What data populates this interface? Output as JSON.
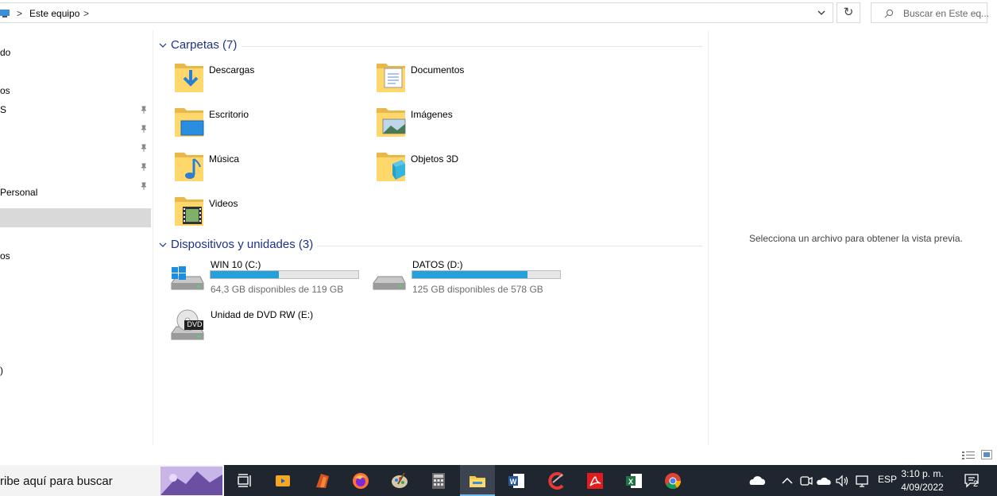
{
  "address": {
    "crumb": "Este equipo",
    "separator": ">",
    "refresh_glyph": "↻"
  },
  "search": {
    "placeholder": "Buscar en Este eq..."
  },
  "nav": {
    "items": [
      {
        "label": "do",
        "pinned": false
      },
      {
        "label": "os",
        "pinned": true
      },
      {
        "label": "S",
        "pinned": true
      },
      {
        "label": "",
        "pinned": true
      },
      {
        "label": "",
        "pinned": true
      },
      {
        "label": "",
        "pinned": true
      },
      {
        "label": "Personal",
        "pinned": false
      },
      {
        "label": "os",
        "pinned": false
      },
      {
        "label": ")",
        "pinned": false
      }
    ]
  },
  "folders_group": {
    "title": "Carpetas (7)"
  },
  "folders": [
    {
      "label": "Descargas",
      "icon": "downloads-folder-icon"
    },
    {
      "label": "Documentos",
      "icon": "documents-folder-icon"
    },
    {
      "label": "Escritorio",
      "icon": "desktop-folder-icon"
    },
    {
      "label": "Imágenes",
      "icon": "pictures-folder-icon"
    },
    {
      "label": "Música",
      "icon": "music-folder-icon"
    },
    {
      "label": "Objetos 3D",
      "icon": "3d-objects-folder-icon"
    },
    {
      "label": "Videos",
      "icon": "videos-folder-icon"
    }
  ],
  "devices_group": {
    "title": "Dispositivos y unidades (3)"
  },
  "drives": [
    {
      "label": "WIN 10 (C:)",
      "free_text": "64,3 GB disponibles de 119 GB",
      "used_fraction": 0.46,
      "icon": "windows-drive-icon"
    },
    {
      "label": "DATOS (D:)",
      "free_text": "125 GB disponibles de 578 GB",
      "used_fraction": 0.78,
      "icon": "hard-drive-icon"
    },
    {
      "label": "Unidad de DVD RW (E:)",
      "icon": "dvd-drive-icon",
      "badge": "DVD"
    }
  ],
  "preview": {
    "message": "Selecciona un archivo para obtener la vista previa."
  },
  "taskbar": {
    "search_placeholder": "ribe aquí para buscar",
    "language": "ESP",
    "time": "3:10 p. m.",
    "date": "4/09/2022",
    "notification_count": "2"
  },
  "colors": {
    "accent": "#26a0da",
    "group_title": "#1e3287",
    "taskbar": "#202630"
  }
}
